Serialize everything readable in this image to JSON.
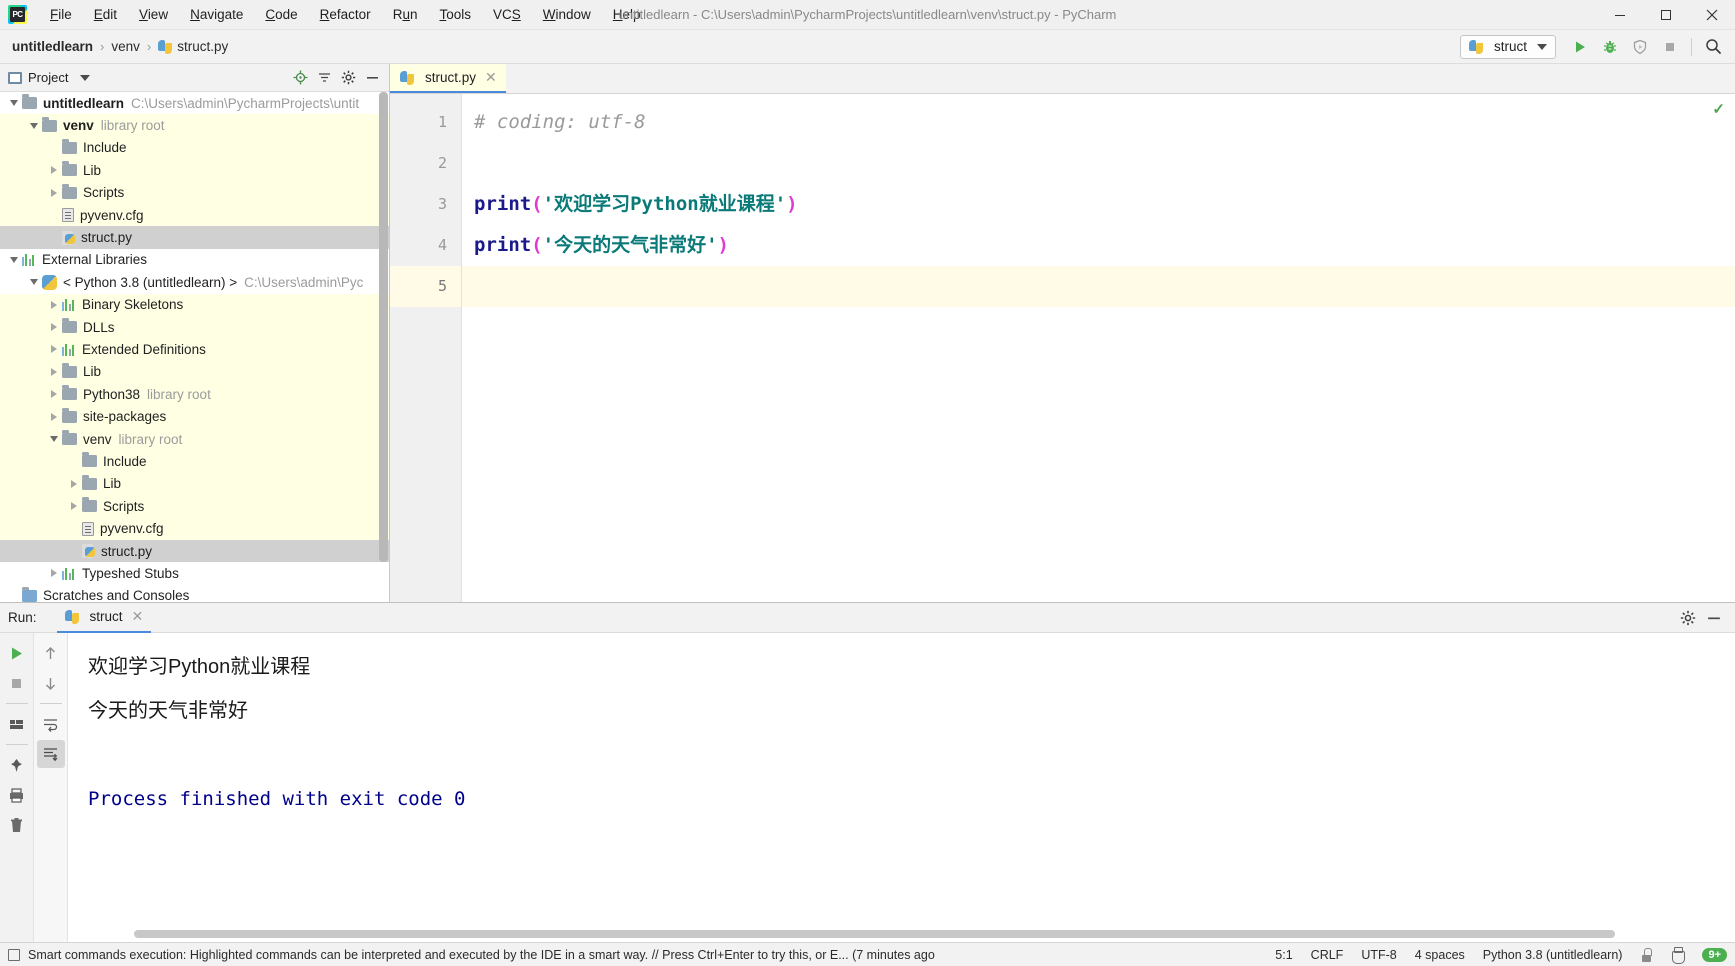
{
  "window": {
    "title": "untitledlearn - C:\\Users\\admin\\PycharmProjects\\untitledlearn\\venv\\struct.py - PyCharm",
    "minimize_label": "—",
    "maximize_label": "☐",
    "close_label": "✕"
  },
  "menubar": [
    {
      "label": "File",
      "mnemonic": "F"
    },
    {
      "label": "Edit",
      "mnemonic": "E"
    },
    {
      "label": "View",
      "mnemonic": "V"
    },
    {
      "label": "Navigate",
      "mnemonic": "N"
    },
    {
      "label": "Code",
      "mnemonic": "C"
    },
    {
      "label": "Refactor",
      "mnemonic": "R"
    },
    {
      "label": "Run",
      "mnemonic": "u"
    },
    {
      "label": "Tools",
      "mnemonic": "T"
    },
    {
      "label": "VCS",
      "mnemonic": "S"
    },
    {
      "label": "Window",
      "mnemonic": "W"
    },
    {
      "label": "Help",
      "mnemonic": "H"
    }
  ],
  "breadcrumb": {
    "items": [
      {
        "label": "untitledlearn",
        "bold": true,
        "icon": null
      },
      {
        "label": "venv",
        "bold": false,
        "icon": null
      },
      {
        "label": "struct.py",
        "bold": false,
        "icon": "python-file-icon"
      }
    ],
    "separator": "›"
  },
  "toolbar": {
    "run_config": {
      "label": "struct",
      "icon": "python-icon"
    },
    "buttons": [
      {
        "name": "run-button",
        "icon": "play-icon",
        "color": "#4caf50"
      },
      {
        "name": "debug-button",
        "icon": "bug-icon",
        "color": "#4caf50"
      },
      {
        "name": "run-coverage-button",
        "icon": "coverage-icon",
        "color": "#9e9e9e"
      },
      {
        "name": "stop-button",
        "icon": "stop-icon",
        "color": "#9e9e9e"
      },
      {
        "name": "search-everywhere-button",
        "icon": "search-icon",
        "color": "#3c3c3c"
      }
    ]
  },
  "project_panel": {
    "title": "Project",
    "header_buttons": [
      {
        "name": "select-opened-file-button",
        "icon": "target-icon"
      },
      {
        "name": "collapse-all-button",
        "icon": "collapse-icon"
      },
      {
        "name": "settings-button",
        "icon": "gear-icon"
      },
      {
        "name": "hide-button",
        "icon": "minimize-icon"
      }
    ],
    "tree": [
      {
        "label": "untitledlearn",
        "sub": "C:\\Users\\admin\\PycharmProjects\\untit",
        "indent": 0,
        "twist": "open",
        "icon": "folder-icon",
        "bold": true,
        "scope": false,
        "selected": false
      },
      {
        "label": "venv",
        "sub": "library root",
        "indent": 1,
        "twist": "open",
        "icon": "folder-icon",
        "bold": true,
        "scope": true,
        "selected": false
      },
      {
        "label": "Include",
        "sub": "",
        "indent": 2,
        "twist": "none",
        "icon": "folder-icon",
        "bold": false,
        "scope": true,
        "selected": false
      },
      {
        "label": "Lib",
        "sub": "",
        "indent": 2,
        "twist": "closed",
        "icon": "folder-icon",
        "bold": false,
        "scope": true,
        "selected": false
      },
      {
        "label": "Scripts",
        "sub": "",
        "indent": 2,
        "twist": "closed",
        "icon": "folder-icon",
        "bold": false,
        "scope": true,
        "selected": false
      },
      {
        "label": "pyvenv.cfg",
        "sub": "",
        "indent": 2,
        "twist": "none",
        "icon": "config-file-icon",
        "bold": false,
        "scope": true,
        "selected": false
      },
      {
        "label": "struct.py",
        "sub": "",
        "indent": 2,
        "twist": "none",
        "icon": "python-file-icon",
        "bold": false,
        "scope": false,
        "selected": true
      },
      {
        "label": "External Libraries",
        "sub": "",
        "indent": 0,
        "twist": "open",
        "icon": "library-icon",
        "bold": false,
        "scope": false,
        "selected": false
      },
      {
        "label": "< Python 3.8 (untitledlearn) >",
        "sub": "C:\\Users\\admin\\Pyc",
        "indent": 1,
        "twist": "open",
        "icon": "python-round-icon",
        "bold": false,
        "scope": false,
        "selected": false
      },
      {
        "label": "Binary Skeletons",
        "sub": "",
        "indent": 2,
        "twist": "closed",
        "icon": "library-icon",
        "bold": false,
        "scope": true,
        "selected": false
      },
      {
        "label": "DLLs",
        "sub": "",
        "indent": 2,
        "twist": "closed",
        "icon": "folder-icon",
        "bold": false,
        "scope": true,
        "selected": false
      },
      {
        "label": "Extended Definitions",
        "sub": "",
        "indent": 2,
        "twist": "closed",
        "icon": "library-icon",
        "bold": false,
        "scope": true,
        "selected": false
      },
      {
        "label": "Lib",
        "sub": "",
        "indent": 2,
        "twist": "closed",
        "icon": "folder-icon",
        "bold": false,
        "scope": true,
        "selected": false
      },
      {
        "label": "Python38",
        "sub": "library root",
        "indent": 2,
        "twist": "closed",
        "icon": "folder-icon",
        "bold": false,
        "scope": true,
        "selected": false
      },
      {
        "label": "site-packages",
        "sub": "",
        "indent": 2,
        "twist": "closed",
        "icon": "folder-icon",
        "bold": false,
        "scope": true,
        "selected": false
      },
      {
        "label": "venv",
        "sub": "library root",
        "indent": 2,
        "twist": "open",
        "icon": "folder-icon",
        "bold": false,
        "scope": true,
        "selected": false
      },
      {
        "label": "Include",
        "sub": "",
        "indent": 3,
        "twist": "none",
        "icon": "folder-icon",
        "bold": false,
        "scope": true,
        "selected": false
      },
      {
        "label": "Lib",
        "sub": "",
        "indent": 3,
        "twist": "closed",
        "icon": "folder-icon",
        "bold": false,
        "scope": true,
        "selected": false
      },
      {
        "label": "Scripts",
        "sub": "",
        "indent": 3,
        "twist": "closed",
        "icon": "folder-icon",
        "bold": false,
        "scope": true,
        "selected": false
      },
      {
        "label": "pyvenv.cfg",
        "sub": "",
        "indent": 3,
        "twist": "none",
        "icon": "config-file-icon",
        "bold": false,
        "scope": true,
        "selected": false
      },
      {
        "label": "struct.py",
        "sub": "",
        "indent": 3,
        "twist": "none",
        "icon": "python-file-icon",
        "bold": false,
        "scope": false,
        "selected": true
      },
      {
        "label": "Typeshed Stubs",
        "sub": "",
        "indent": 2,
        "twist": "closed",
        "icon": "library-icon",
        "bold": false,
        "scope": false,
        "selected": false
      },
      {
        "label": "Scratches and Consoles",
        "sub": "",
        "indent": 0,
        "twist": "none",
        "icon": "scratch-icon",
        "bold": false,
        "scope": false,
        "selected": false
      }
    ]
  },
  "editor": {
    "tab": {
      "label": "struct.py",
      "icon": "python-file-icon",
      "close": "✕"
    },
    "inspection_ok_glyph": "✓",
    "lines": [
      {
        "num": "1",
        "current": false,
        "tokens": [
          {
            "t": "# coding: utf-8",
            "c": "comment"
          }
        ]
      },
      {
        "num": "2",
        "current": false,
        "tokens": []
      },
      {
        "num": "3",
        "current": false,
        "tokens": [
          {
            "t": "print",
            "c": "fn"
          },
          {
            "t": "(",
            "c": "paren"
          },
          {
            "t": "'欢迎学习Python就业课程'",
            "c": "str"
          },
          {
            "t": ")",
            "c": "paren"
          }
        ]
      },
      {
        "num": "4",
        "current": false,
        "tokens": [
          {
            "t": "print",
            "c": "fn"
          },
          {
            "t": "(",
            "c": "paren"
          },
          {
            "t": "'今天的天气非常好'",
            "c": "str"
          },
          {
            "t": ")",
            "c": "paren"
          }
        ]
      },
      {
        "num": "5",
        "current": true,
        "tokens": []
      }
    ]
  },
  "run_panel": {
    "label": "Run:",
    "tab": {
      "label": "struct",
      "icon": "python-icon",
      "close": "✕"
    },
    "header_buttons": [
      {
        "name": "run-settings-button",
        "icon": "gear-icon"
      },
      {
        "name": "hide-run-panel-button",
        "icon": "minimize-icon"
      }
    ],
    "toolbar": [
      {
        "name": "rerun-button",
        "icon": "play-icon"
      },
      {
        "name": "stop-button",
        "icon": "stop-icon"
      },
      {
        "name": "restore-layout-button",
        "icon": "layout-icon"
      },
      {
        "name": "pin-tab-button",
        "icon": "pin-icon"
      },
      {
        "name": "print-button",
        "icon": "printer-icon"
      },
      {
        "name": "clear-all-button",
        "icon": "trash-icon"
      }
    ],
    "toolbar2": [
      {
        "name": "up-stacktrace-button",
        "icon": "arrow-up-icon"
      },
      {
        "name": "down-stacktrace-button",
        "icon": "arrow-down-icon"
      },
      {
        "name": "soft-wrap-button",
        "icon": "wrap-icon"
      },
      {
        "name": "scroll-to-end-button",
        "icon": "scroll-end-icon",
        "active": true
      }
    ],
    "console_lines": [
      {
        "text": "欢迎学习Python就业课程",
        "mono": false
      },
      {
        "text": "今天的天气非常好",
        "mono": false
      },
      {
        "text": "",
        "mono": false
      },
      {
        "text": "Process finished with exit code 0",
        "mono": true
      }
    ]
  },
  "statusbar": {
    "message": "Smart commands execution: Highlighted commands can be interpreted and executed by the IDE in a smart way. // Press Ctrl+Enter to try this, or E... (7 minutes ago",
    "caret_position": "5:1",
    "line_separator": "CRLF",
    "encoding": "UTF-8",
    "indent": "4 spaces",
    "interpreter": "Python 3.8 (untitledlearn)",
    "notification_count": "9+"
  }
}
